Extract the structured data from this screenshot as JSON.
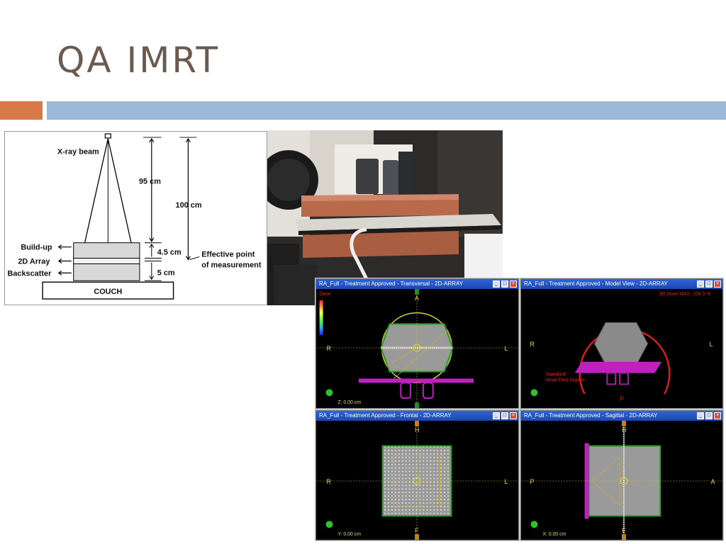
{
  "slide": {
    "title": "QA IMRT"
  },
  "diagram": {
    "xray_beam": "X-ray beam",
    "dist_95": "95 cm",
    "dist_100": "100 cm",
    "build_up": "Build-up",
    "array_2d": "2D Array",
    "backscatter": "Backscatter",
    "dist_45": "4.5 cm",
    "dist_5": "5 cm",
    "effective_point_1": "Effective point",
    "effective_point_2": "of measurement",
    "couch": "COUCH"
  },
  "tps": {
    "transversal": {
      "title": "RA_Full - Treatment Approved - Transversal - 2D-ARRAY",
      "a": "A",
      "r": "R",
      "l": "L",
      "dose_label": "Dose",
      "z_readout": "Z: 0.00 cm"
    },
    "model": {
      "title": "RA_Full - Treatment Approved - Model View - 2D-ARRAY",
      "max_label": "3D Dose MAX: 108.0 %",
      "r": "R",
      "l": "L",
      "p": "P",
      "orientation_1": "Standard",
      "orientation_2": "Head First-Supine"
    },
    "frontal": {
      "title": "RA_Full - Treatment Approved - Frontal - 2D-ARRAY",
      "h": "H",
      "f": "F",
      "r": "R",
      "l": "L",
      "y_readout": "Y: 0.00 cm"
    },
    "sagittal": {
      "title": "RA_Full - Treatment Approved - Sagittal - 2D-ARRAY",
      "h": "H",
      "f": "F",
      "p": "P",
      "a": "A",
      "x_readout": "X: 0.00 cm"
    }
  },
  "colors": {
    "title": "#6b5a50",
    "accent_orange": "#d8794a",
    "accent_blue": "#9bb9d8"
  }
}
